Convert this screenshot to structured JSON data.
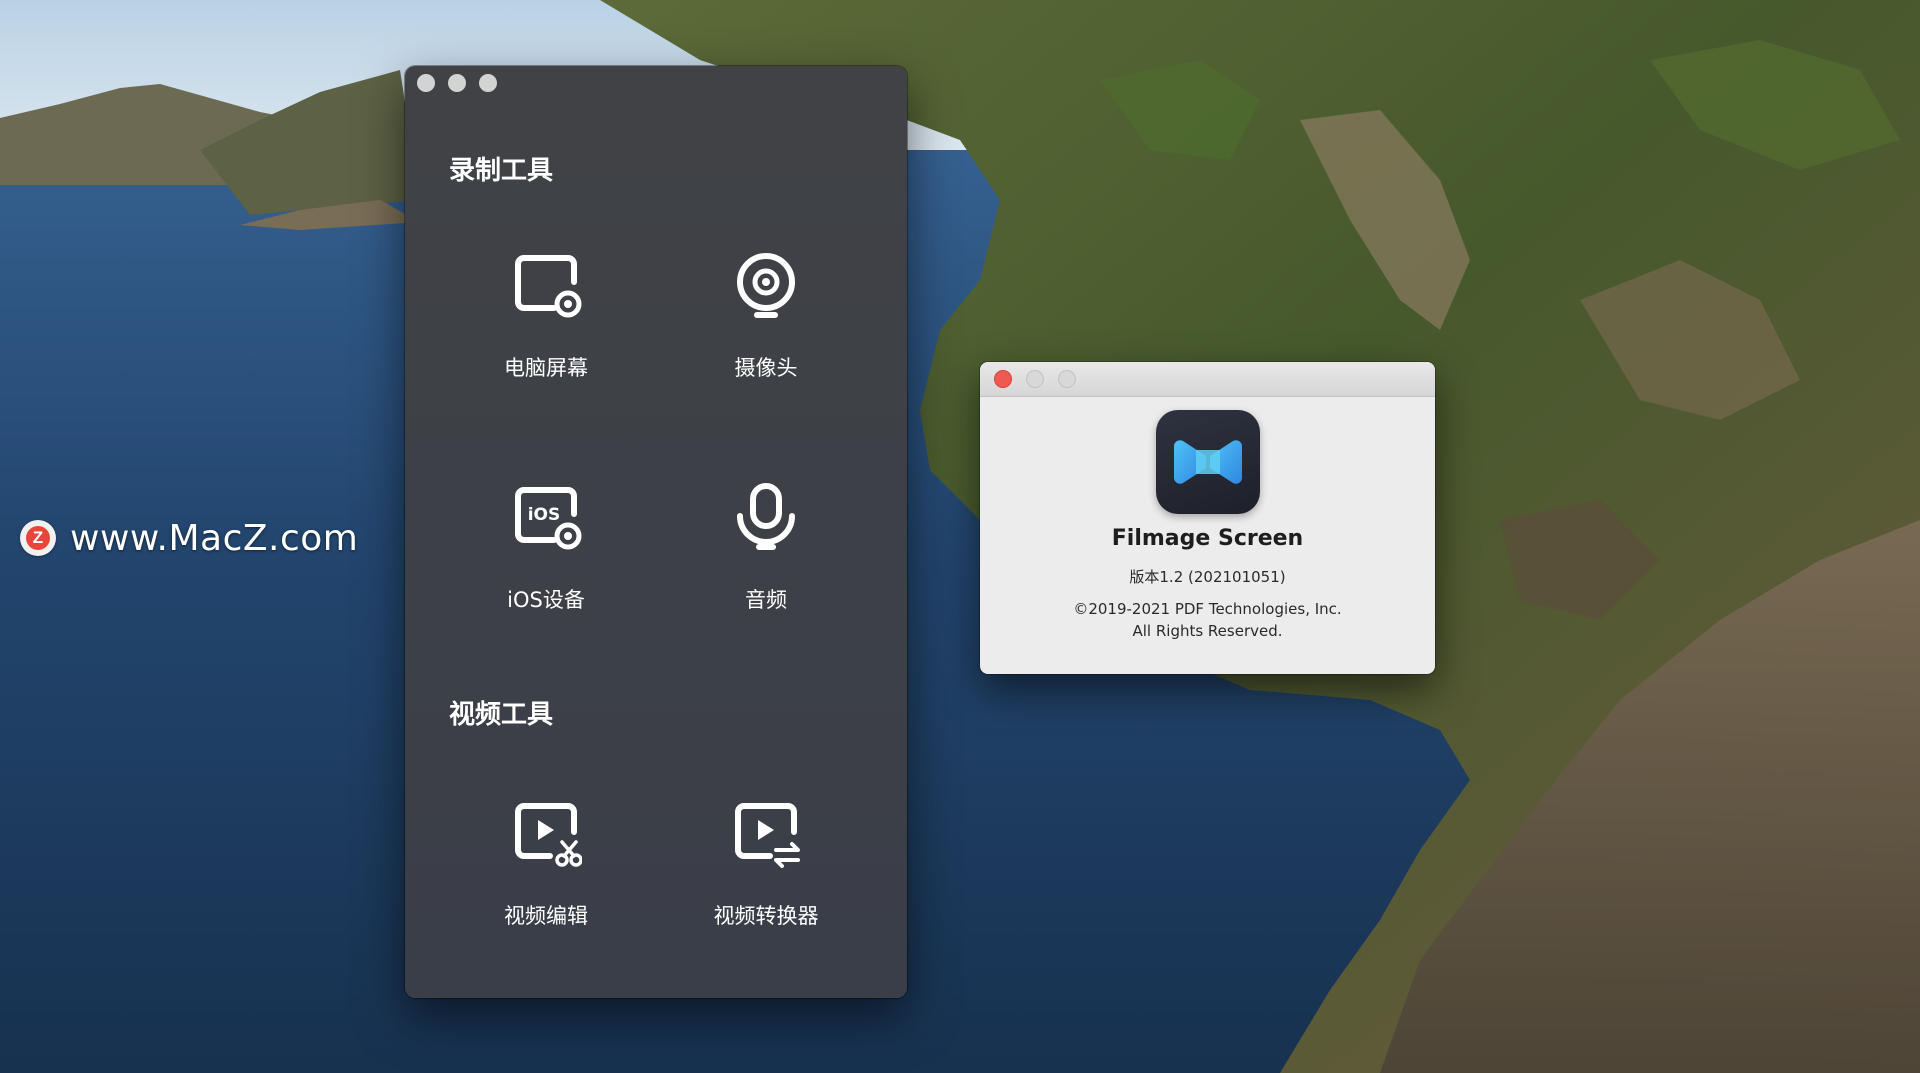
{
  "watermark": {
    "logo_letter": "Z",
    "text": "www.MacZ.com"
  },
  "main_window": {
    "recording_section_title": "录制工具",
    "recording_tools": [
      {
        "label": "电脑屏幕",
        "icon": "screen-record-icon"
      },
      {
        "label": "摄像头",
        "icon": "webcam-icon"
      },
      {
        "label": "iOS设备",
        "icon": "ios-device-icon"
      },
      {
        "label": "音频",
        "icon": "microphone-icon"
      }
    ],
    "video_section_title": "视频工具",
    "video_tools": [
      {
        "label": "视频编辑",
        "icon": "video-edit-icon"
      },
      {
        "label": "视频转换器",
        "icon": "video-convert-icon"
      }
    ],
    "ios_badge_text": "iOS"
  },
  "about_window": {
    "app_name": "Filmage Screen",
    "version": "版本1.2 (202101051)",
    "copyright": "©2019-2021 PDF Technologies, Inc.",
    "rights": "All Rights Reserved.",
    "app_icon": "filmage-screen-app-icon"
  },
  "colors": {
    "window_bg": "#3e4047",
    "icon_color": "#ffffff",
    "about_bg": "#ececec",
    "close_red": "#ee5a52",
    "app_icon_blue": "#3aa8ef"
  }
}
